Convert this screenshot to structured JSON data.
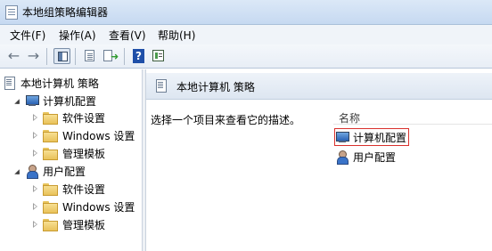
{
  "window": {
    "title": "本地组策略编辑器"
  },
  "menu": [
    "文件(F)",
    "操作(A)",
    "查看(V)",
    "帮助(H)"
  ],
  "toolbar": {
    "back": "←",
    "forward": "→",
    "help": "?"
  },
  "tree": {
    "root": "本地计算机 策略",
    "computer": {
      "label": "计算机配置",
      "children": [
        "软件设置",
        "Windows 设置",
        "管理模板"
      ]
    },
    "user": {
      "label": "用户配置",
      "children": [
        "软件设置",
        "Windows 设置",
        "管理模板"
      ]
    }
  },
  "right_pane": {
    "header_title": "本地计算机 策略",
    "description": "选择一个项目来查看它的描述。",
    "column_name": "名称",
    "items": [
      "计算机配置",
      "用户配置"
    ]
  },
  "colors": {
    "highlight_box": "#d9302c",
    "titlebar": "#c6d9f1"
  }
}
